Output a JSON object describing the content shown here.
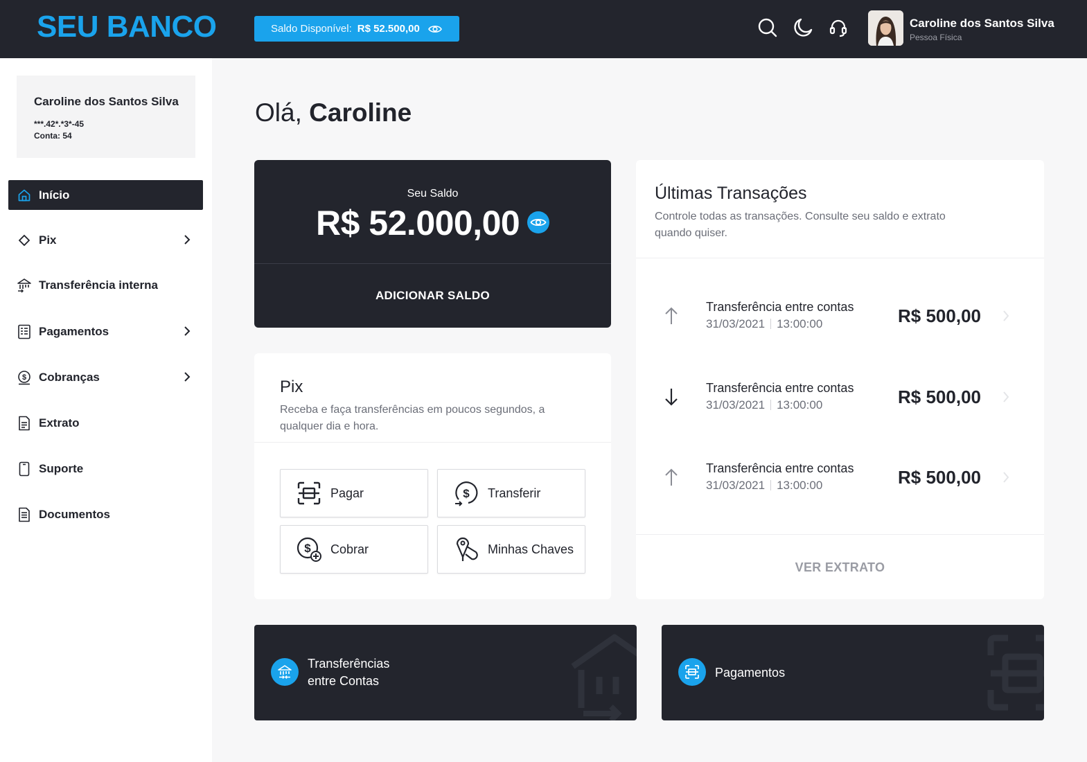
{
  "header": {
    "logo": "SEU BANCO",
    "saldo_label": "Saldo Disponível:",
    "saldo_value": "R$ 52.500,00",
    "user_name": "Caroline dos Santos Silva",
    "user_type": "Pessoa Física",
    "icons": [
      "search-icon",
      "moon-icon",
      "headset-icon",
      "eye-icon"
    ]
  },
  "sidebar": {
    "account": {
      "name": "Caroline dos Santos Silva",
      "document": "***.42*.*3*-45",
      "conta": "Conta: 54"
    },
    "items": [
      {
        "label": "Início",
        "icon": "home-icon",
        "active": true,
        "has_submenu": false
      },
      {
        "label": "Pix",
        "icon": "pix-icon",
        "active": false,
        "has_submenu": true
      },
      {
        "label": "Transferência interna",
        "icon": "bank-transfer-icon",
        "active": false,
        "has_submenu": false
      },
      {
        "label": "Pagamentos",
        "icon": "payments-icon",
        "active": false,
        "has_submenu": true
      },
      {
        "label": "Cobranças",
        "icon": "charge-icon",
        "active": false,
        "has_submenu": true
      },
      {
        "label": "Extrato",
        "icon": "statement-icon",
        "active": false,
        "has_submenu": false
      },
      {
        "label": "Suporte",
        "icon": "phone-icon",
        "active": false,
        "has_submenu": false
      },
      {
        "label": "Documentos",
        "icon": "documents-icon",
        "active": false,
        "has_submenu": false
      }
    ]
  },
  "main": {
    "greeting_prefix": "Olá,",
    "greeting_name": "Caroline",
    "balance": {
      "label": "Seu Saldo",
      "amount": "R$ 52.000,00",
      "add_button": "ADICIONAR SALDO"
    },
    "pix": {
      "title": "Pix",
      "description": "Receba e faça transferências em poucos segundos, a qualquer dia e hora.",
      "actions": [
        {
          "label": "Pagar",
          "icon": "scan-icon"
        },
        {
          "label": "Transferir",
          "icon": "dollar-transfer-icon"
        },
        {
          "label": "Cobrar",
          "icon": "dollar-add-icon"
        },
        {
          "label": "Minhas Chaves",
          "icon": "keys-icon"
        }
      ]
    },
    "transactions": {
      "title": "Últimas Transações",
      "description": "Controle todas as transações. Consulte seu saldo e extrato quando quiser.",
      "items": [
        {
          "direction": "up",
          "name": "Transferência entre contas",
          "date": "31/03/2021",
          "time": "13:00:00",
          "amount": "R$ 500,00"
        },
        {
          "direction": "down",
          "name": "Transferência entre contas",
          "date": "31/03/2021",
          "time": "13:00:00",
          "amount": "R$ 500,00"
        },
        {
          "direction": "up",
          "name": "Transferência entre contas",
          "date": "31/03/2021",
          "time": "13:00:00",
          "amount": "R$ 500,00"
        }
      ],
      "view_statement": "VER EXTRATO"
    },
    "promos": [
      {
        "line1": "Transferências",
        "line2": "entre Contas",
        "icon": "bank-transfer-icon"
      },
      {
        "line1": "Pagamentos",
        "icon": "scan-icon"
      }
    ]
  },
  "colors": {
    "accent": "#1aa3ec",
    "dark": "#23252d",
    "background": "#f7f7f8"
  }
}
